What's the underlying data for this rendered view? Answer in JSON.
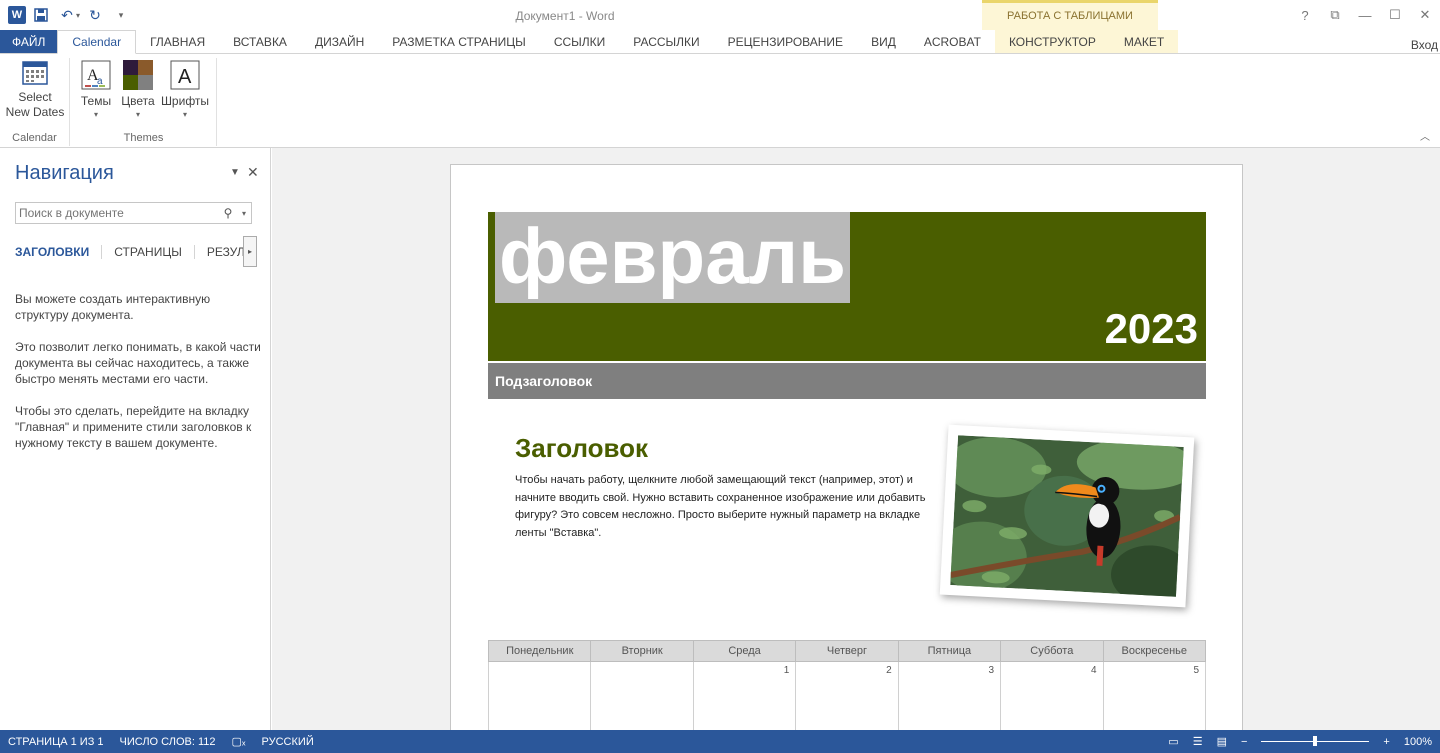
{
  "app": {
    "doc_title": "Документ1 - Word",
    "context_group": "РАБОТА С ТАБЛИЦАМИ",
    "signin": "Вход",
    "quick_access": [
      "word-logo-icon",
      "save-icon",
      "undo-icon",
      "redo-icon",
      "customize-icon"
    ],
    "window_controls": [
      "?",
      "⧉",
      "—",
      "☐",
      "✕"
    ]
  },
  "tabs": [
    {
      "label": "ФАЙЛ",
      "kind": "file"
    },
    {
      "label": "Calendar",
      "kind": "active"
    },
    {
      "label": "ГЛАВНАЯ",
      "kind": "normal"
    },
    {
      "label": "ВСТАВКА",
      "kind": "normal"
    },
    {
      "label": "ДИЗАЙН",
      "kind": "normal"
    },
    {
      "label": "РАЗМЕТКА СТРАНИЦЫ",
      "kind": "normal"
    },
    {
      "label": "ССЫЛКИ",
      "kind": "normal"
    },
    {
      "label": "РАССЫЛКИ",
      "kind": "normal"
    },
    {
      "label": "РЕЦЕНЗИРОВАНИЕ",
      "kind": "normal"
    },
    {
      "label": "ВИД",
      "kind": "normal"
    },
    {
      "label": "ACROBAT",
      "kind": "normal"
    },
    {
      "label": "КОНСТРУКТОР",
      "kind": "ctx"
    },
    {
      "label": "МАКЕТ",
      "kind": "ctx"
    }
  ],
  "ribbon": {
    "calendar_group": {
      "label": "Calendar",
      "select_dates_line1": "Select",
      "select_dates_line2": "New Dates"
    },
    "themes_group": {
      "label": "Themes",
      "themes": "Темы",
      "colors": "Цвета",
      "fonts": "Шрифты"
    }
  },
  "nav": {
    "title": "Навигация",
    "search_placeholder": "Поиск в документе",
    "tabs": [
      "ЗАГОЛОВКИ",
      "СТРАНИЦЫ",
      "РЕЗУЛЬТАТЫ"
    ],
    "paragraphs": [
      "Вы можете создать интерактивную структуру документа.",
      "Это позволит легко понимать, в какой части документа вы сейчас находитесь, а также быстро менять местами его части.",
      "Чтобы это сделать, перейдите на вкладку \"Главная\" и примените стили заголовков к нужному тексту в вашем документе."
    ]
  },
  "document": {
    "month": "февраль",
    "year": "2023",
    "subtitle": "Подзаголовок",
    "heading": "Заголовок",
    "body": "Чтобы начать работу, щелкните любой замещающий текст (например, этот) и начните вводить свой. Нужно вставить сохраненное изображение или добавить фигуру? Это совсем несложно. Просто выберите нужный параметр на вкладке ленты \"Вставка\".",
    "photo": "toucan-photo",
    "colors": {
      "banner": "#4a5e00",
      "month_highlight": "#b9b9b9",
      "subbar": "#7f7f7f",
      "heading": "#4a5e00"
    },
    "weekdays": [
      "Понедельник",
      "Вторник",
      "Среда",
      "Четверг",
      "Пятница",
      "Суббота",
      "Воскресенье"
    ],
    "first_week": [
      "",
      "",
      "1",
      "2",
      "3",
      "4",
      "5"
    ]
  },
  "status": {
    "page": "СТРАНИЦА 1 ИЗ 1",
    "words": "ЧИСЛО СЛОВ: 112",
    "language": "РУССКИЙ",
    "zoom": "100%",
    "zoom_fraction": 0.5,
    "accent": "#2b579a"
  }
}
